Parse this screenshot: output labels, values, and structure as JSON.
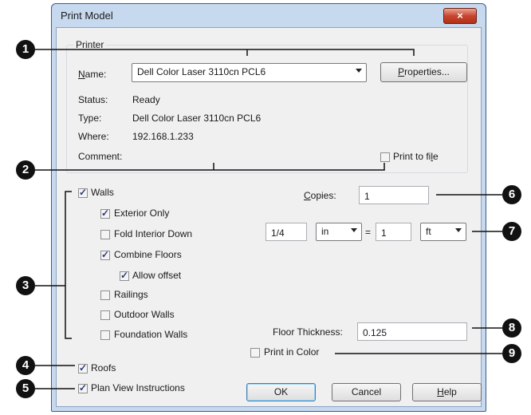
{
  "window": {
    "title": "Print Model",
    "close_glyph": "×"
  },
  "printer": {
    "group_label": "Printer",
    "name_label": "Name:",
    "name_value": "Dell Color Laser 3110cn PCL6",
    "properties_button": "Properties...",
    "status_label": "Status:",
    "status_value": "Ready",
    "type_label": "Type:",
    "type_value": "Dell Color Laser 3110cn PCL6",
    "where_label": "Where:",
    "where_value": "192.168.1.233",
    "comment_label": "Comment:",
    "print_to_file_label": "Print to file",
    "print_to_file_checked": false
  },
  "options": {
    "walls": {
      "label": "Walls",
      "checked": true
    },
    "exterior_only": {
      "label": "Exterior Only",
      "checked": true
    },
    "fold_interior_down": {
      "label": "Fold Interior Down",
      "checked": false
    },
    "combine_floors": {
      "label": "Combine Floors",
      "checked": true
    },
    "allow_offset": {
      "label": "Allow offset",
      "checked": true
    },
    "railings": {
      "label": "Railings",
      "checked": false
    },
    "outdoor_walls": {
      "label": "Outdoor Walls",
      "checked": false
    },
    "foundation_walls": {
      "label": "Foundation Walls",
      "checked": false
    },
    "roofs": {
      "label": "Roofs",
      "checked": true
    },
    "plan_view_instructions": {
      "label": "Plan View Instructions",
      "checked": true
    },
    "print_in_color": {
      "label": "Print in Color",
      "checked": false
    }
  },
  "copies": {
    "label": "Copies:",
    "value": "1"
  },
  "scale": {
    "left_value": "1/4",
    "left_unit": "in",
    "equals": "=",
    "right_value": "1",
    "right_unit": "ft"
  },
  "floor_thickness": {
    "label": "Floor Thickness:",
    "value": "0.125"
  },
  "buttons": {
    "ok": "OK",
    "cancel": "Cancel",
    "help": "Help"
  },
  "callouts": [
    "1",
    "2",
    "3",
    "4",
    "5",
    "6",
    "7",
    "8",
    "9"
  ]
}
